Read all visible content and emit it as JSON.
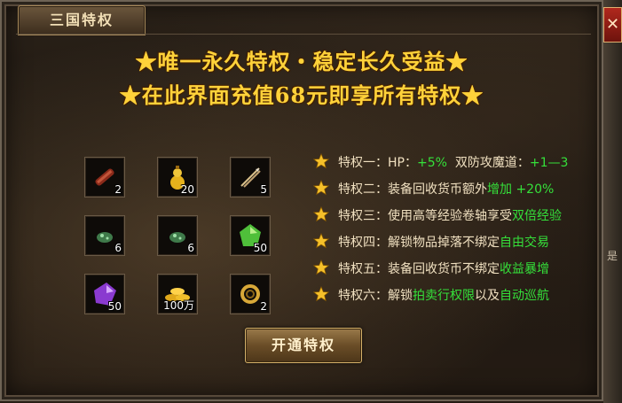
{
  "window": {
    "tab_title": "三国特权",
    "close_label": "✕",
    "side_mark": "是"
  },
  "headlines": {
    "line1": "★唯一永久特权・稳定长久受益★",
    "line2": "★在此界面充值68元即享所有特权★"
  },
  "items": [
    {
      "icon": "red-scroll-icon",
      "qty": "2"
    },
    {
      "icon": "gold-gourd-icon",
      "qty": "20"
    },
    {
      "icon": "arrows-icon",
      "qty": "5"
    },
    {
      "icon": "green-ore-icon",
      "qty": "6"
    },
    {
      "icon": "green-ore-icon",
      "qty": "6"
    },
    {
      "icon": "green-gem-icon",
      "qty": "50"
    },
    {
      "icon": "purple-gem-icon",
      "qty": "50"
    },
    {
      "icon": "gold-ingots-icon",
      "qty": "100万"
    },
    {
      "icon": "gold-ring-icon",
      "qty": "2"
    }
  ],
  "privileges": [
    {
      "label": "特权一：",
      "text": "HP：",
      "highlight": "+5%",
      "text2": "  双防攻魔道：",
      "highlight2": "+1—3"
    },
    {
      "label": "特权二：",
      "text": "装备回收货币额外",
      "highlight": "增加 +20%",
      "text2": "",
      "highlight2": ""
    },
    {
      "label": "特权三：",
      "text": "使用高等经验卷轴享受",
      "highlight": "双倍经验",
      "text2": "",
      "highlight2": ""
    },
    {
      "label": "特权四：",
      "text": "解锁物品掉落不绑定",
      "highlight": "自由交易",
      "text2": "",
      "highlight2": ""
    },
    {
      "label": "特权五：",
      "text": "装备回收货币不绑定",
      "highlight": "收益暴增",
      "text2": "",
      "highlight2": ""
    },
    {
      "label": "特权六：",
      "text": "解锁",
      "highlight": "拍卖行权限",
      "text2": "以及",
      "highlight2": "自动巡航"
    }
  ],
  "button": {
    "label": "开通特权"
  },
  "colors": {
    "gold": "#ffd23a",
    "green": "#35e03a",
    "text": "#f0e0c0"
  }
}
